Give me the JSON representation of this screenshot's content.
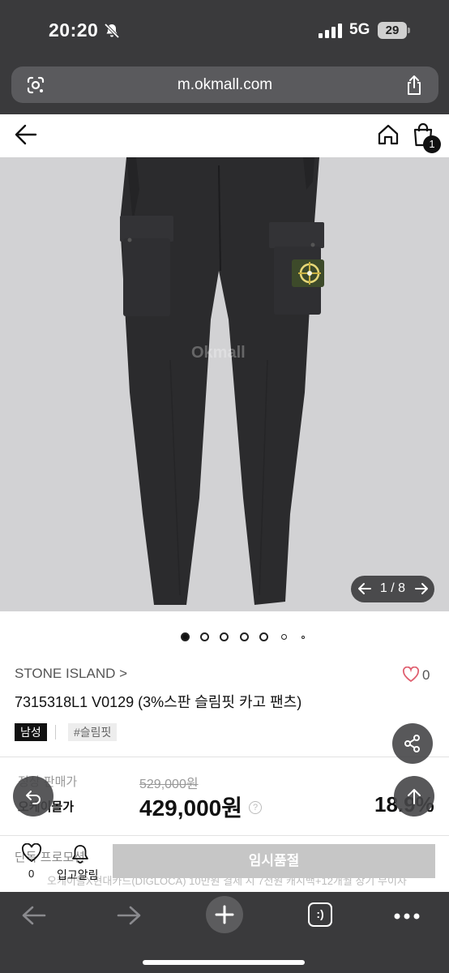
{
  "status": {
    "time": "20:20",
    "network": "5G",
    "battery": "29"
  },
  "browser": {
    "url": "m.okmall.com",
    "tab_label": ":)"
  },
  "header": {
    "cart_count": "1"
  },
  "gallery": {
    "counter": "1 / 8",
    "watermark": "Okmall",
    "dot_count": 7,
    "active_dot": 0
  },
  "product": {
    "brand": "STONE ISLAND >",
    "likes": "0",
    "title": "7315318L1 V0129 (3%스판 슬림핏 카고 팬츠)",
    "tags": [
      "남성",
      "#슬림핏"
    ]
  },
  "price": {
    "regular_label": "정상 판매가",
    "regular": "529,000원",
    "okmall_label": "오케이몰가",
    "sale": "429,000원",
    "discount": "18.9%"
  },
  "promo": {
    "label": "단독 프로모션",
    "text": "오케이몰X현대카드(DIGLOCA) 10만원 결제 시 7천원 캐시백+12개월 장기 무이자"
  },
  "bottom_bar": {
    "like_count": "0",
    "alarm_label": "입고알림",
    "cta_label": "임시품절"
  },
  "colors": {
    "chrome": "#3a3a3c",
    "image_bg": "#d2d2d4",
    "cta_disabled": "#c6c6c6",
    "heart": "#e06070"
  }
}
